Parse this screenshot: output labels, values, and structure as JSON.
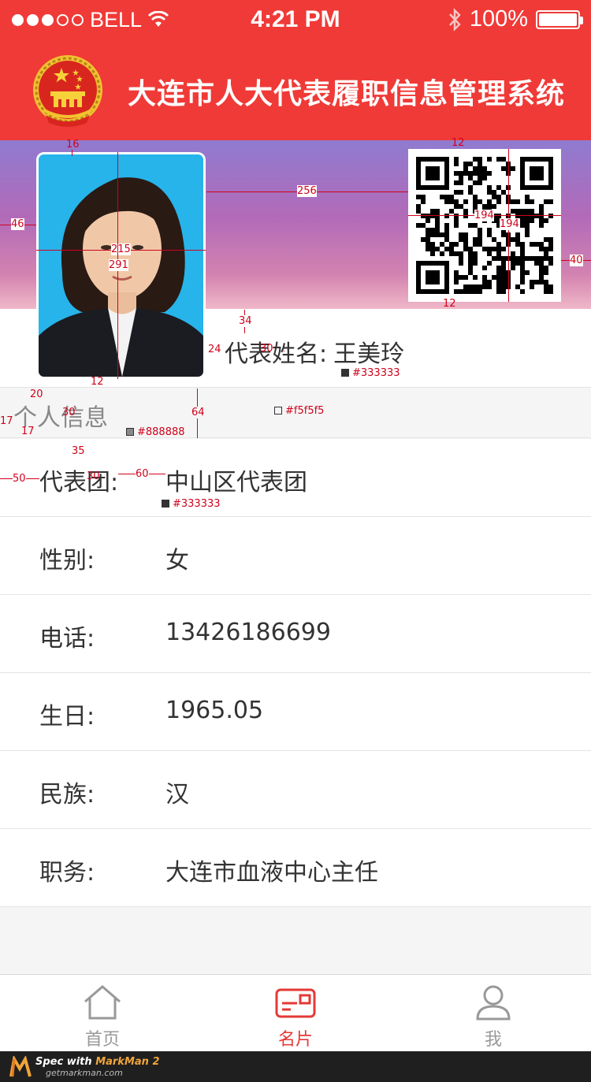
{
  "status_bar": {
    "carrier": "BELL",
    "time": "4:21 PM",
    "battery": "100%"
  },
  "header": {
    "title": "大连市人大代表履职信息管理系统"
  },
  "profile": {
    "name_label": "代表姓名:",
    "name_value": "王美玲"
  },
  "section": {
    "title": "个人信息"
  },
  "info_rows": [
    {
      "label": "代表团:",
      "value": "中山区代表团"
    },
    {
      "label": "性别:",
      "value": "女"
    },
    {
      "label": "电话:",
      "value": "13426186699"
    },
    {
      "label": "生日:",
      "value": "1965.05"
    },
    {
      "label": "民族:",
      "value": "汉"
    },
    {
      "label": "职务:",
      "value": "大连市血液中心主任"
    }
  ],
  "tabbar": {
    "tabs": [
      {
        "label": "首页",
        "icon": "home-icon",
        "active": false
      },
      {
        "label": "名片",
        "icon": "card-icon",
        "active": true
      },
      {
        "label": "我",
        "icon": "user-icon",
        "active": false
      }
    ]
  },
  "footer": {
    "spec_prefix": "Spec with ",
    "brand": "MarkMan 2",
    "site": "getmarkman.com"
  },
  "annotations": {
    "photo_top": "16",
    "photo_left": "46",
    "photo_to_qr": "256",
    "photo_width": "215",
    "photo_height": "291",
    "qr_top": "12",
    "qr_size_w": "194",
    "qr_size_h": "194",
    "qr_right": "40",
    "qr_bottom": "12",
    "name_top": "34",
    "name_font": "30",
    "name_color": "#333333",
    "photo_to_name": "24",
    "photo_bottom": "12",
    "section_top": "20",
    "section_left": "17",
    "section_inner": "17",
    "section_font": "30",
    "section_color": "#888888",
    "section_height": "64",
    "section_bg": "#f5f5f5",
    "row_top": "35",
    "row_left": "50",
    "row_font": "30",
    "row_gap": "60",
    "row_color": "#333333"
  },
  "colors": {
    "header_bg": "#f03a37",
    "accent": "#e53935",
    "text": "#333333",
    "muted": "#888888",
    "section_bg": "#f5f5f5"
  }
}
